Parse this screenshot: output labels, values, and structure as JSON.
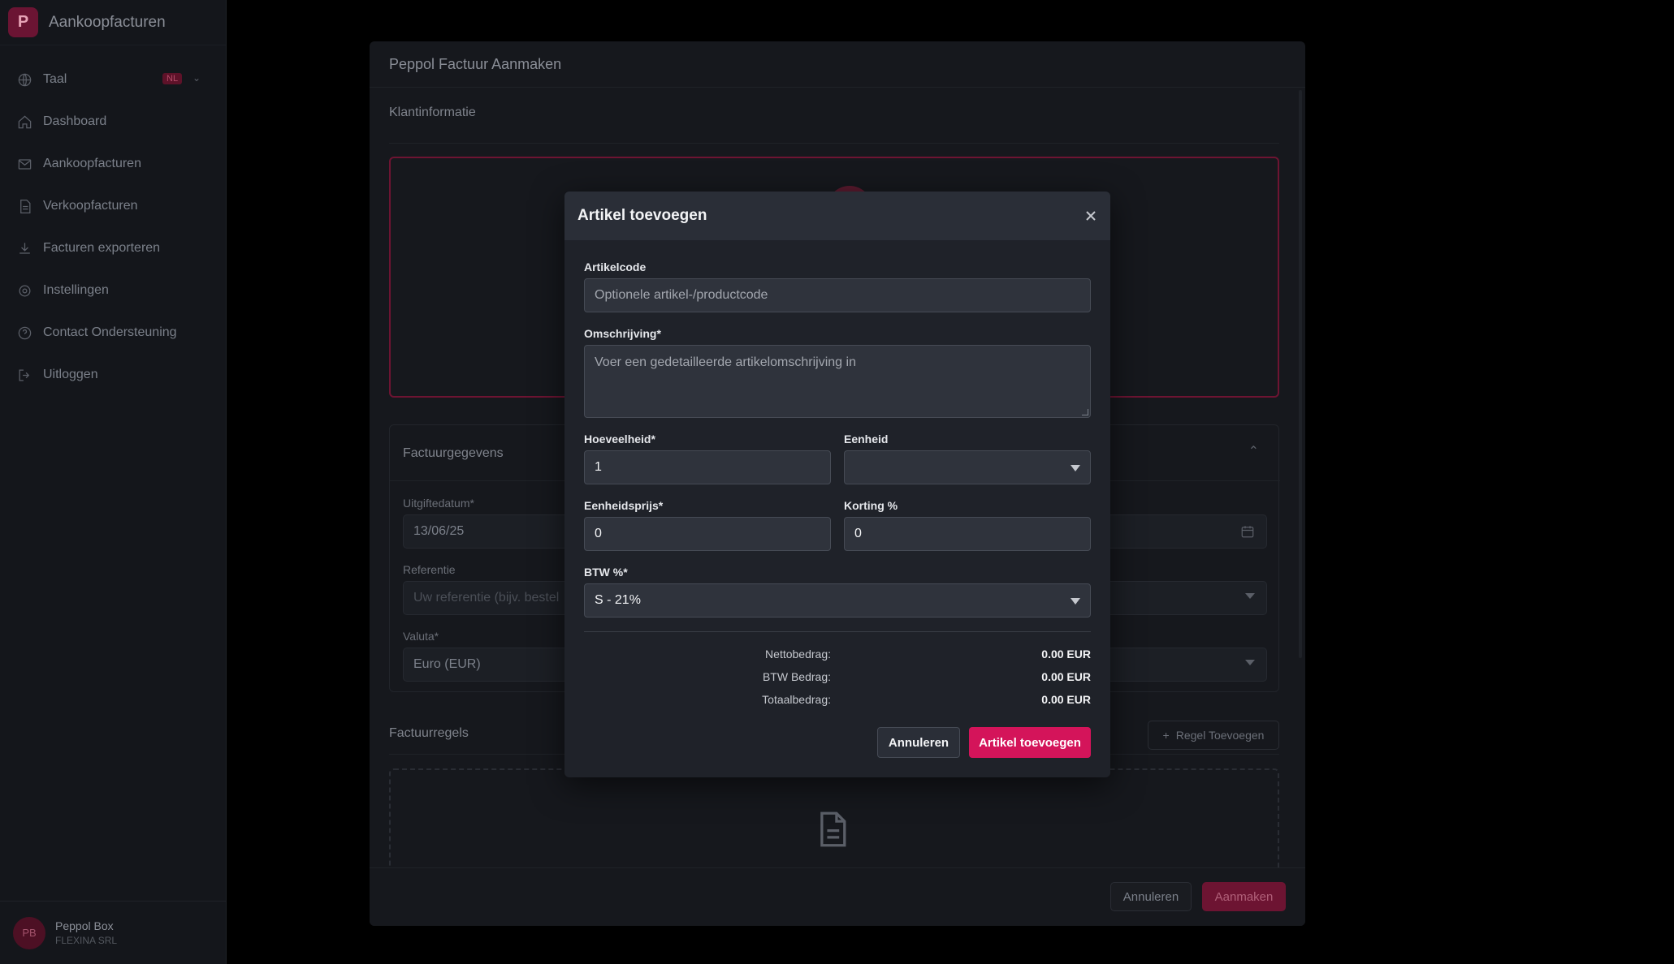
{
  "app": {
    "logo_letter": "P",
    "title": "Aankoopfacturen"
  },
  "sidebar": {
    "language": {
      "label": "Taal",
      "badge": "NL"
    },
    "items": [
      {
        "label": "Dashboard",
        "icon": "home-icon"
      },
      {
        "label": "Aankoopfacturen",
        "icon": "mail-icon"
      },
      {
        "label": "Verkoopfacturen",
        "icon": "document-icon"
      },
      {
        "label": "Facturen exporteren",
        "icon": "download-icon"
      },
      {
        "label": "Instellingen",
        "icon": "gear-icon"
      },
      {
        "label": "Contact Ondersteuning",
        "icon": "help-icon"
      },
      {
        "label": "Uitloggen",
        "icon": "logout-icon"
      }
    ],
    "user": {
      "initials": "PB",
      "name": "Peppol Box",
      "company": "FLEXINA SRL"
    }
  },
  "page": {
    "title": "Peppol Factuur Aanmaken",
    "klant_section": "Klantinformatie",
    "factuur_section": "Factuurgegevens",
    "fields": {
      "uitgiftedatum_label": "Uitgiftedatum*",
      "uitgiftedatum_value": "13/06/25",
      "referentie_label": "Referentie",
      "referentie_placeholder": "Uw referentie (bijv. bestel",
      "valuta_label": "Valuta*",
      "valuta_value": "Euro (EUR)"
    },
    "regels_section": "Factuurregels",
    "add_line_button": "Regel Toevoegen",
    "footer": {
      "cancel": "Annuleren",
      "create": "Aanmaken"
    }
  },
  "modal": {
    "title": "Artikel toevoegen",
    "artikelcode": {
      "label": "Artikelcode",
      "placeholder": "Optionele artikel-/productcode"
    },
    "omschrijving": {
      "label": "Omschrijving*",
      "placeholder": "Voer een gedetailleerde artikelomschrijving in"
    },
    "hoeveelheid": {
      "label": "Hoeveelheid*",
      "value": "1"
    },
    "eenheid": {
      "label": "Eenheid",
      "value": ""
    },
    "eenheidsprijs": {
      "label": "Eenheidsprijs*",
      "value": "0"
    },
    "korting": {
      "label": "Korting %",
      "value": "0"
    },
    "btw": {
      "label": "BTW %*",
      "value": "S - 21%"
    },
    "summary": [
      {
        "label": "Nettobedrag:",
        "value": "0.00 EUR"
      },
      {
        "label": "BTW Bedrag:",
        "value": "0.00 EUR"
      },
      {
        "label": "Totaalbedrag:",
        "value": "0.00 EUR"
      }
    ],
    "cancel_button": "Annuleren",
    "add_button": "Artikel toevoegen"
  },
  "colors": {
    "accent": "#d4145a",
    "modal_bg": "#1f2229",
    "modal_header": "#2a2e37"
  }
}
